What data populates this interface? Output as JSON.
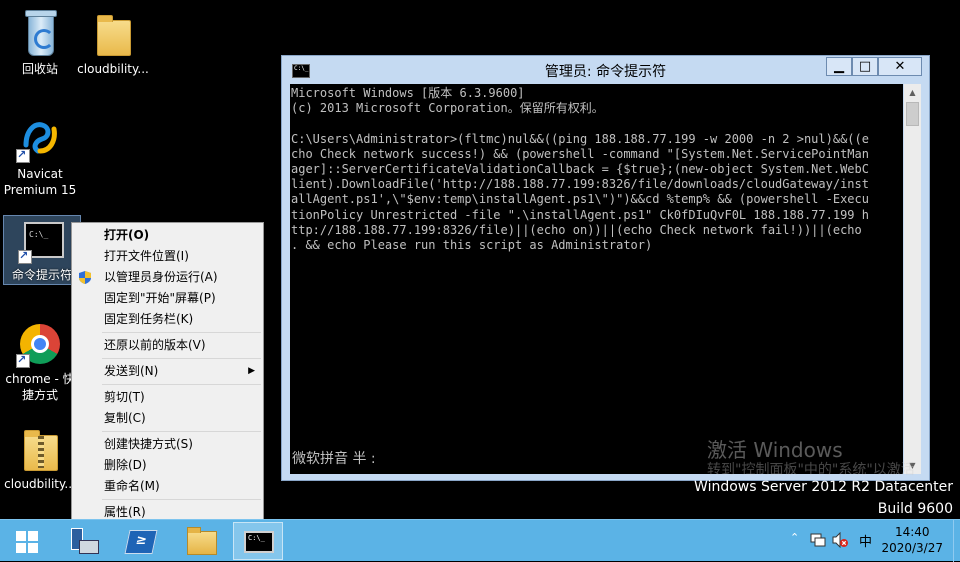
{
  "desktop": {
    "icons": [
      {
        "label": "回收站",
        "icon": "recycle-bin-icon"
      },
      {
        "label": "cloudbility...",
        "icon": "folder-icon"
      },
      {
        "label": "Navicat Premium 15",
        "icon": "navicat-icon"
      },
      {
        "label": "命令提示符",
        "icon": "command-prompt-icon"
      },
      {
        "label": "chrome - 快捷方式",
        "icon": "chrome-icon"
      },
      {
        "label": "cloudbility...",
        "icon": "zip-folder-icon"
      }
    ]
  },
  "context_menu": {
    "items": [
      {
        "label": "打开(O)",
        "bold": true
      },
      {
        "label": "打开文件位置(I)"
      },
      {
        "label": "以管理员身份运行(A)",
        "icon": "uac-shield-icon"
      },
      {
        "label": "固定到\"开始\"屏幕(P)"
      },
      {
        "label": "固定到任务栏(K)"
      },
      {
        "label": "还原以前的版本(V)"
      },
      {
        "label": "发送到(N)",
        "submenu": true,
        "submenu_arrow": "▶"
      },
      {
        "label": "剪切(T)"
      },
      {
        "label": "复制(C)"
      },
      {
        "label": "创建快捷方式(S)"
      },
      {
        "label": "删除(D)"
      },
      {
        "label": "重命名(M)"
      },
      {
        "label": "属性(R)"
      }
    ]
  },
  "cmd_window": {
    "title": "管理员: 命令提示符",
    "icon_text": "C:\\_",
    "buttons": {
      "minimize": "▁",
      "maximize": "□",
      "close": "✕"
    },
    "console_lines": [
      "Microsoft Windows [版本 6.3.9600]",
      "(c) 2013 Microsoft Corporation。保留所有权利。",
      "",
      "C:\\Users\\Administrator>(fltmc)nul&&((ping 188.188.77.199 -w 2000 -n 2 >nul)&&((e",
      "cho Check network success!) && (powershell -command \"[System.Net.ServicePointMan",
      "ager]::ServerCertificateValidationCallback = {$true};(new-object System.Net.WebC",
      "lient).DownloadFile('http://188.188.77.199:8326/file/downloads/cloudGateway/inst",
      "allAgent.ps1',\\\"$env:temp\\installAgent.ps1\\\")\")&&cd %temp% && (powershell -Execu",
      "tionPolicy Unrestricted -file \".\\installAgent.ps1\" Ck0fDIuQvF0L 188.188.77.199 h",
      "ttp://188.188.77.199:8326/file)||(echo on))||(echo Check network fail!))||(echo",
      ". && echo Please run this script as Administrator)"
    ],
    "ime_status": "微软拼音 半 :"
  },
  "watermark": {
    "line1": "激活 Windows",
    "line2": "转到\"控制面板\"中的\"系统\"以激活"
  },
  "os_version": {
    "line1": "Windows Server 2012 R2 Datacenter",
    "line2": "Build 9600"
  },
  "taskbar": {
    "items": [
      {
        "name": "start",
        "icon": "windows-logo-icon"
      },
      {
        "name": "server-manager",
        "icon": "server-manager-icon"
      },
      {
        "name": "powershell",
        "icon": "powershell-icon",
        "glyph": "≥"
      },
      {
        "name": "file-explorer",
        "icon": "folder-icon"
      },
      {
        "name": "command-prompt",
        "icon": "command-prompt-icon",
        "active": true
      }
    ],
    "tray": {
      "chevron": "⌃",
      "network_icon": "network-icon",
      "volume_icon": "volume-muted-icon",
      "ime": "中",
      "time": "14:40",
      "date": "2020/3/27"
    }
  },
  "colors": {
    "taskbar": "#5bb3e6",
    "window_frame": "#c5daf2",
    "console_text": "#c0c0c0"
  }
}
